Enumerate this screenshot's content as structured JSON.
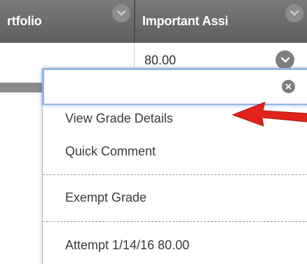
{
  "grid": {
    "columns": [
      {
        "label": "rtfolio",
        "menu_icon": "chevron-down-icon"
      },
      {
        "label": "Important Assi",
        "menu_icon": "chevron-down-icon"
      }
    ],
    "row": {
      "grade_value": "80.00",
      "menu_icon": "chevron-down-icon"
    }
  },
  "context_menu": {
    "search_value": "",
    "close_icon": "close-icon",
    "items": [
      {
        "label": "View Grade Details"
      },
      {
        "label": "Quick Comment"
      },
      {
        "label": "Exempt Grade"
      },
      {
        "label": "Attempt 1/14/16 80.00"
      }
    ]
  },
  "annotation": {
    "type": "arrow",
    "color": "#e2231a",
    "points_to": "View Grade Details"
  },
  "colors": {
    "header_bg": "#6b6b6b",
    "focus_ring": "#8fb6e6",
    "text": "#3a3a3a"
  }
}
